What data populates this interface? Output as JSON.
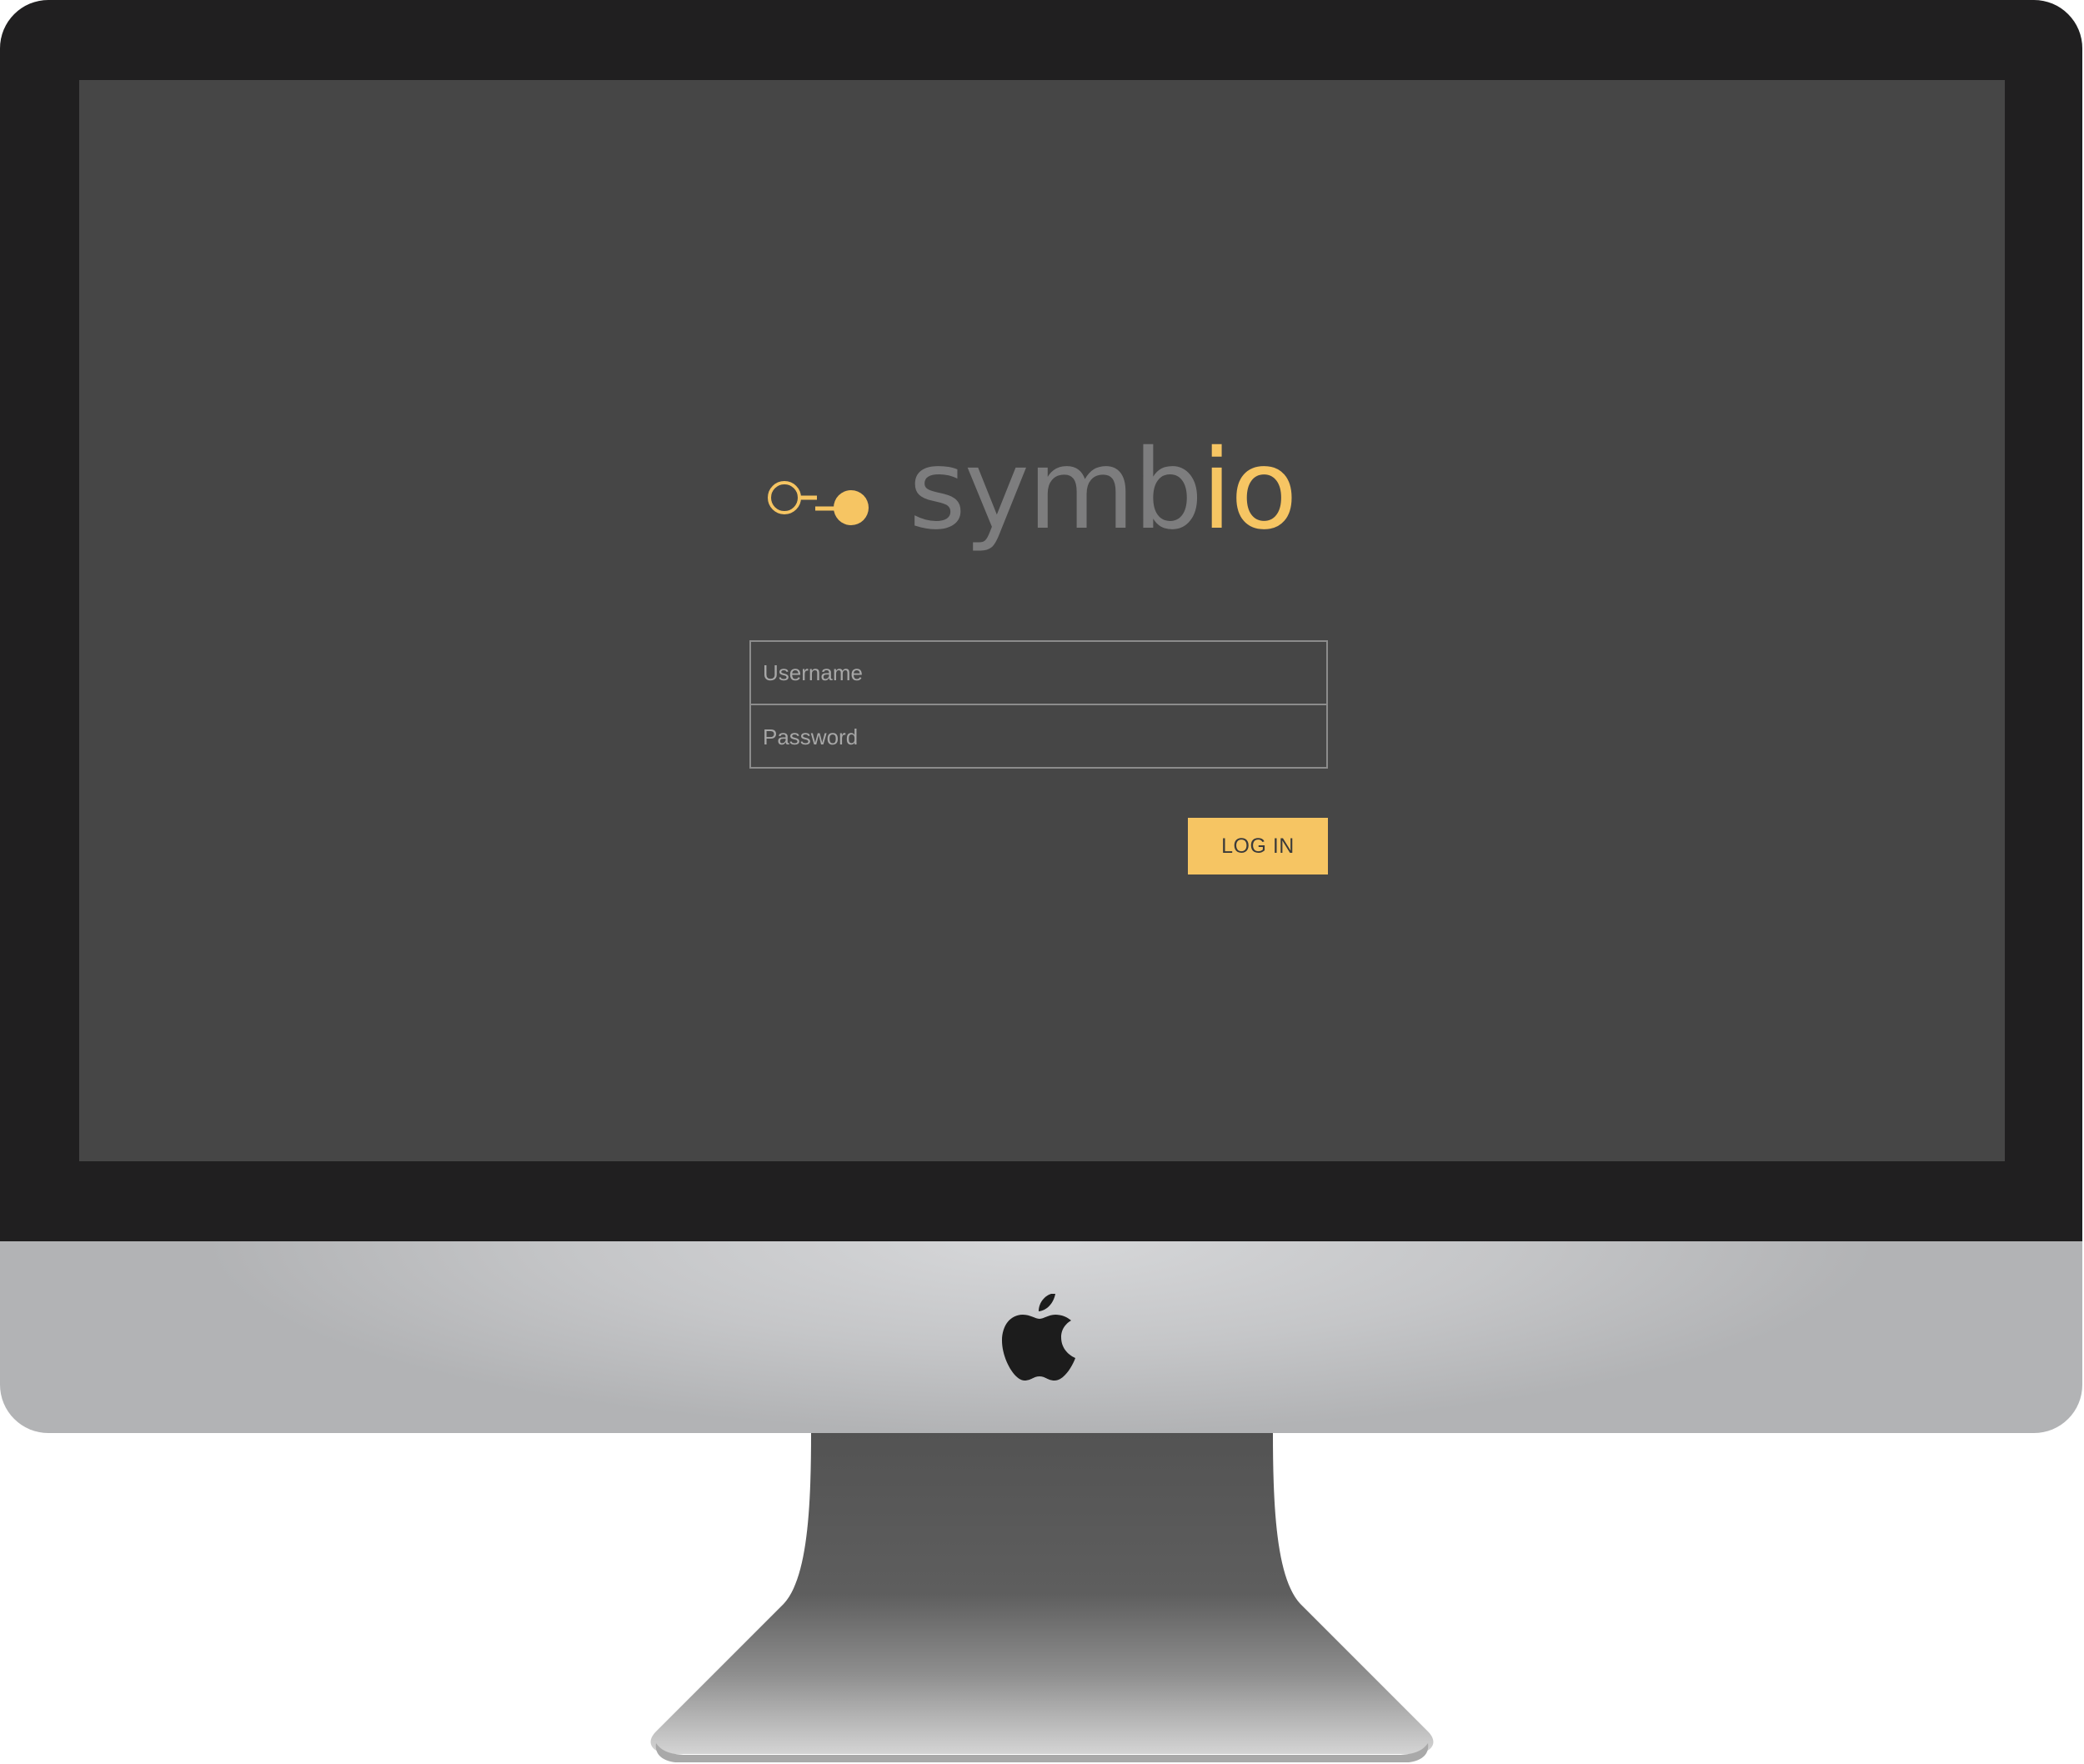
{
  "brand": {
    "name_gray_part": "symb",
    "name_gold_part": "io",
    "accent_color": "#f6c563",
    "text_gray_color": "#7d7d7e"
  },
  "login_form": {
    "username_placeholder": "Username",
    "password_placeholder": "Password",
    "submit_label": "LOG IN"
  },
  "device": {
    "type": "iMac",
    "chin_icon": "apple-logo-icon",
    "screen_color": "#464646",
    "bezel_color": "#201f20"
  }
}
